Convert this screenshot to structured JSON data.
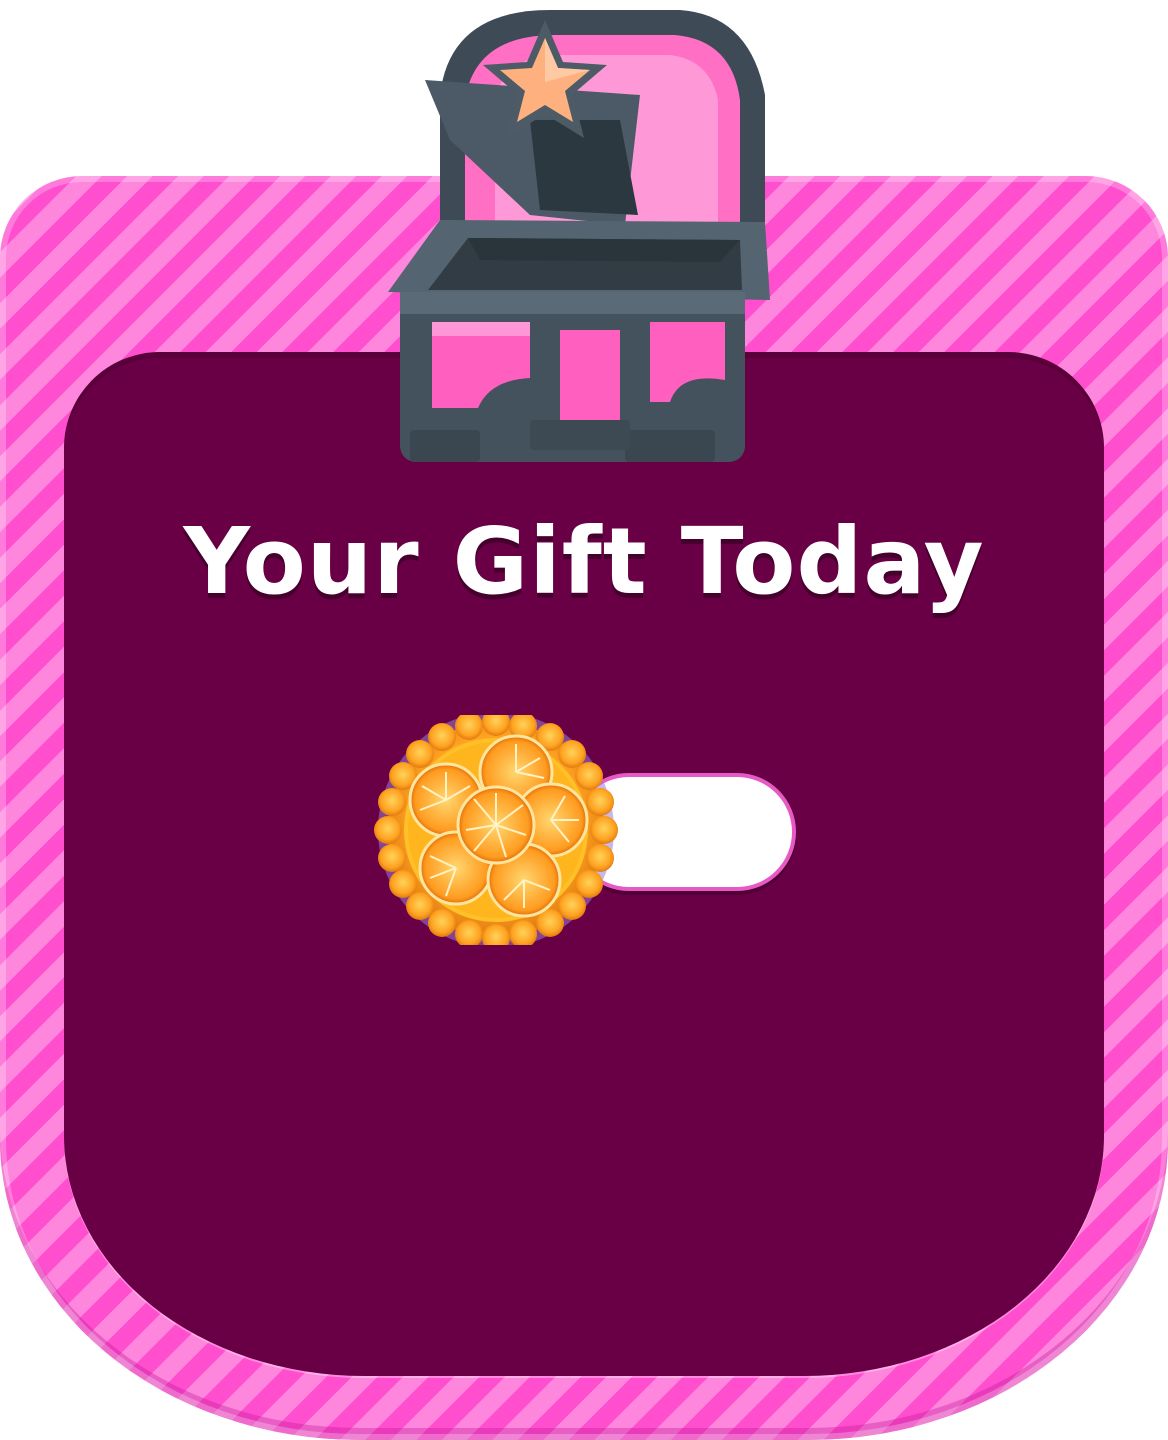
{
  "dialog": {
    "title": "Your Gift Today"
  },
  "chest": {
    "icon": "treasure-chest-icon"
  },
  "reward": {
    "icon": "orange-tart-icon",
    "amount": ""
  },
  "colors": {
    "frame_stripe_dark": "#ff4fcf",
    "frame_stripe_light": "#ff86dd",
    "panel": "#690046",
    "title_text": "#ffffff",
    "pill_border": "#e65ac6"
  }
}
